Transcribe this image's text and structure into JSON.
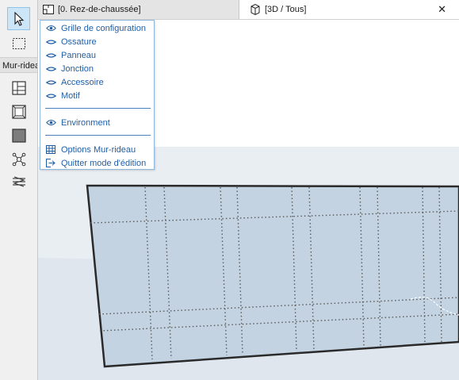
{
  "toolbox": {
    "label": "Mur-rideau",
    "tools": [
      {
        "name": "arrow-select-tool",
        "selected": true
      },
      {
        "name": "marquee-tool",
        "selected": false
      },
      {
        "name": "scheme-tool",
        "selected": false
      },
      {
        "name": "frame-tool",
        "selected": false
      },
      {
        "name": "panel-tool",
        "selected": false
      },
      {
        "name": "junction-tool",
        "selected": false
      },
      {
        "name": "accessory-tool",
        "selected": false
      }
    ]
  },
  "tabs": [
    {
      "label": "[0. Rez-de-chaussée]",
      "active": false,
      "icon": "floor-plan-icon"
    },
    {
      "label": "[3D / Tous]",
      "active": true,
      "icon": "3d-view-icon"
    }
  ],
  "tab_close": "✕",
  "menu": {
    "visibility_items": [
      {
        "label": "Grille de configuration",
        "icon": "eye-open-icon"
      },
      {
        "label": "Ossature",
        "icon": "eye-closed-icon"
      },
      {
        "label": "Panneau",
        "icon": "eye-closed-icon"
      },
      {
        "label": "Jonction",
        "icon": "eye-closed-icon"
      },
      {
        "label": "Accessoire",
        "icon": "eye-closed-icon"
      },
      {
        "label": "Motif",
        "icon": "eye-closed-icon"
      }
    ],
    "environment": {
      "label": "Environment",
      "icon": "eye-open-icon"
    },
    "actions": [
      {
        "label": "Options Mur-rideau",
        "icon": "curtain-wall-settings-icon"
      },
      {
        "label": "Quitter mode d'édition",
        "icon": "exit-edit-icon"
      }
    ]
  },
  "colors": {
    "accent": "#1f5fa8",
    "panel_fill": "#c3d3e2",
    "ground": "#e4eaf0",
    "selection": "#cde6f7"
  }
}
